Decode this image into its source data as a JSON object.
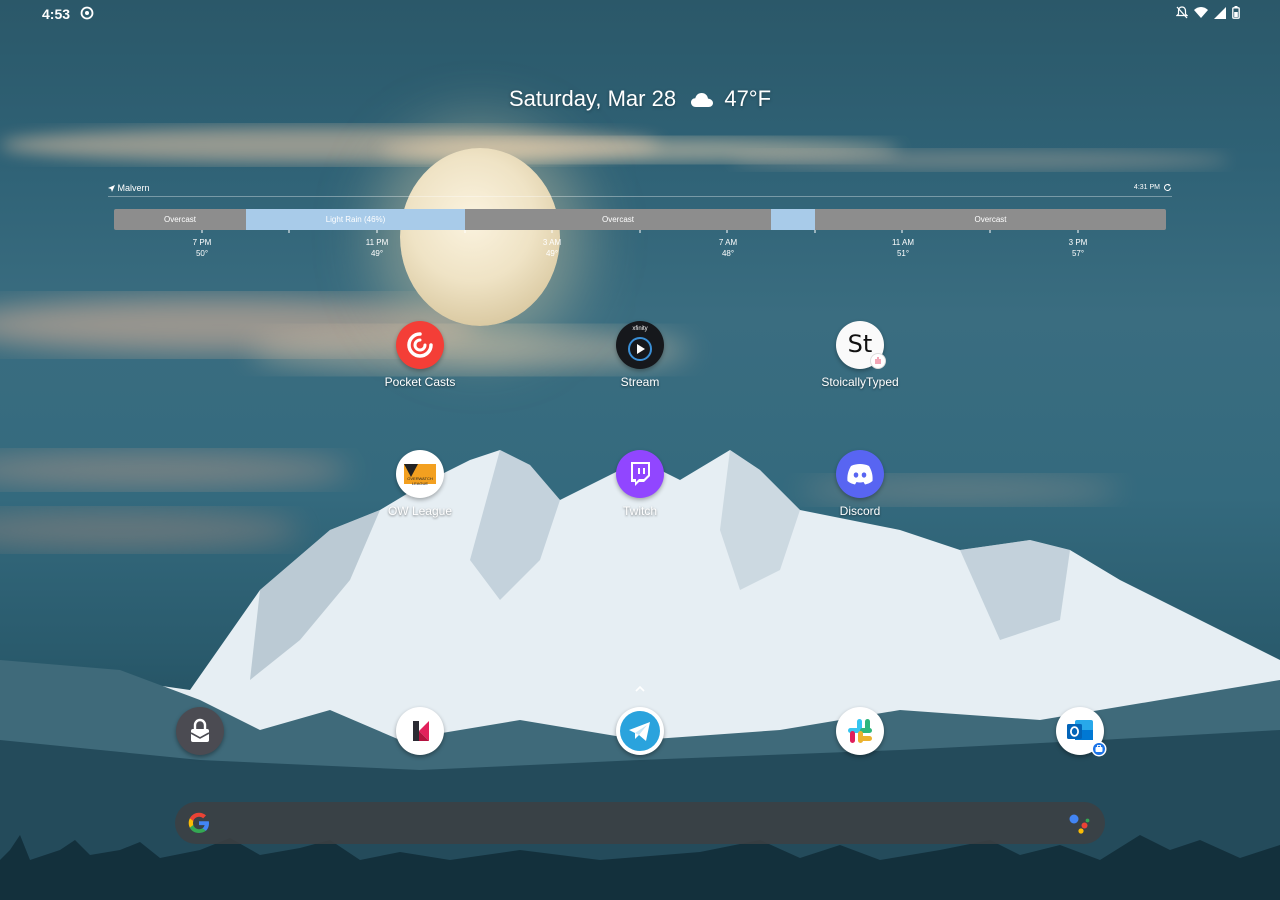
{
  "status_bar": {
    "time": "4:53",
    "icons": [
      "sync-icon",
      "notifications-off-icon",
      "wifi-icon",
      "cell-signal-icon",
      "battery-icon"
    ]
  },
  "date_weather": {
    "date": "Saturday, Mar 28",
    "temperature": "47°F",
    "icon": "cloud-icon"
  },
  "forecast": {
    "location": "Malvern",
    "updated": "4:31 PM",
    "colors": {
      "overcast": "#8d8d8d",
      "rain": "#a8cbe9"
    },
    "segments": [
      {
        "label": "Overcast",
        "kind": "overcast"
      },
      {
        "label": "Light Rain (46%)",
        "kind": "rain"
      },
      {
        "label": "Overcast",
        "kind": "overcast"
      },
      {
        "label": "",
        "kind": "rain"
      },
      {
        "label": "Overcast",
        "kind": "overcast"
      }
    ],
    "hours": [
      {
        "time": "7 PM",
        "temp": "50°"
      },
      {
        "time": "11 PM",
        "temp": "49°"
      },
      {
        "time": "3 AM",
        "temp": "49°"
      },
      {
        "time": "7 AM",
        "temp": "48°"
      },
      {
        "time": "11 AM",
        "temp": "51°"
      },
      {
        "time": "3 PM",
        "temp": "57°"
      }
    ]
  },
  "apps": [
    {
      "label": "Pocket Casts",
      "icon": "pocket-casts-icon"
    },
    {
      "label": "Stream",
      "icon": "xfinity-stream-icon",
      "badge_text": "xfinity"
    },
    {
      "label": "StoicallyTyped",
      "icon": "stoically-typed-icon",
      "glyph": "St"
    },
    {
      "label": "OW League",
      "icon": "overwatch-league-icon",
      "glyph_lines": [
        "OVERWATCH",
        "LEAGUE"
      ]
    },
    {
      "label": "Twitch",
      "icon": "twitch-icon"
    },
    {
      "label": "Discord",
      "icon": "discord-icon"
    }
  ],
  "dock": [
    {
      "name": "protonvpn",
      "icon": "vpn-lock-icon"
    },
    {
      "name": "klarna",
      "icon": "k-app-icon"
    },
    {
      "name": "telegram",
      "icon": "telegram-icon"
    },
    {
      "name": "slack",
      "icon": "slack-icon"
    },
    {
      "name": "outlook",
      "icon": "outlook-icon"
    }
  ],
  "search": {
    "google_icon": "google-g-icon",
    "assistant_icon": "assistant-icon"
  }
}
